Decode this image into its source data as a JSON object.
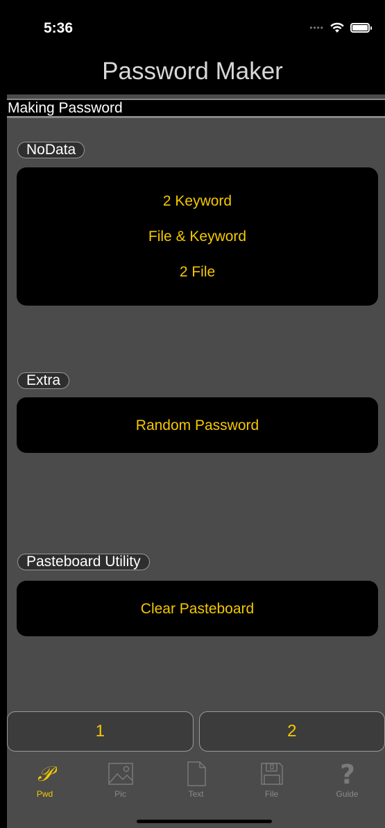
{
  "status": {
    "time": "5:36"
  },
  "header": {
    "title": "Password Maker"
  },
  "section_title": "Making Password",
  "groups": [
    {
      "label": "NoData",
      "items": [
        "2 Keyword",
        "File & Keyword",
        "2 File"
      ]
    },
    {
      "label": "Extra",
      "items": [
        "Random Password"
      ]
    },
    {
      "label": "Pasteboard Utility",
      "items": [
        "Clear Pasteboard"
      ]
    }
  ],
  "segments": [
    "1",
    "2"
  ],
  "tabs": [
    {
      "label": "Pwd",
      "icon": "script-p-icon",
      "active": true
    },
    {
      "label": "Pic",
      "icon": "picture-icon",
      "active": false
    },
    {
      "label": "Text",
      "icon": "document-icon",
      "active": false
    },
    {
      "label": "File",
      "icon": "floppy-disk-icon",
      "active": false
    },
    {
      "label": "Guide",
      "icon": "question-mark-icon",
      "active": false
    }
  ],
  "colors": {
    "accent": "#f5c800",
    "background": "#4b4b4b",
    "panel": "#000000"
  }
}
